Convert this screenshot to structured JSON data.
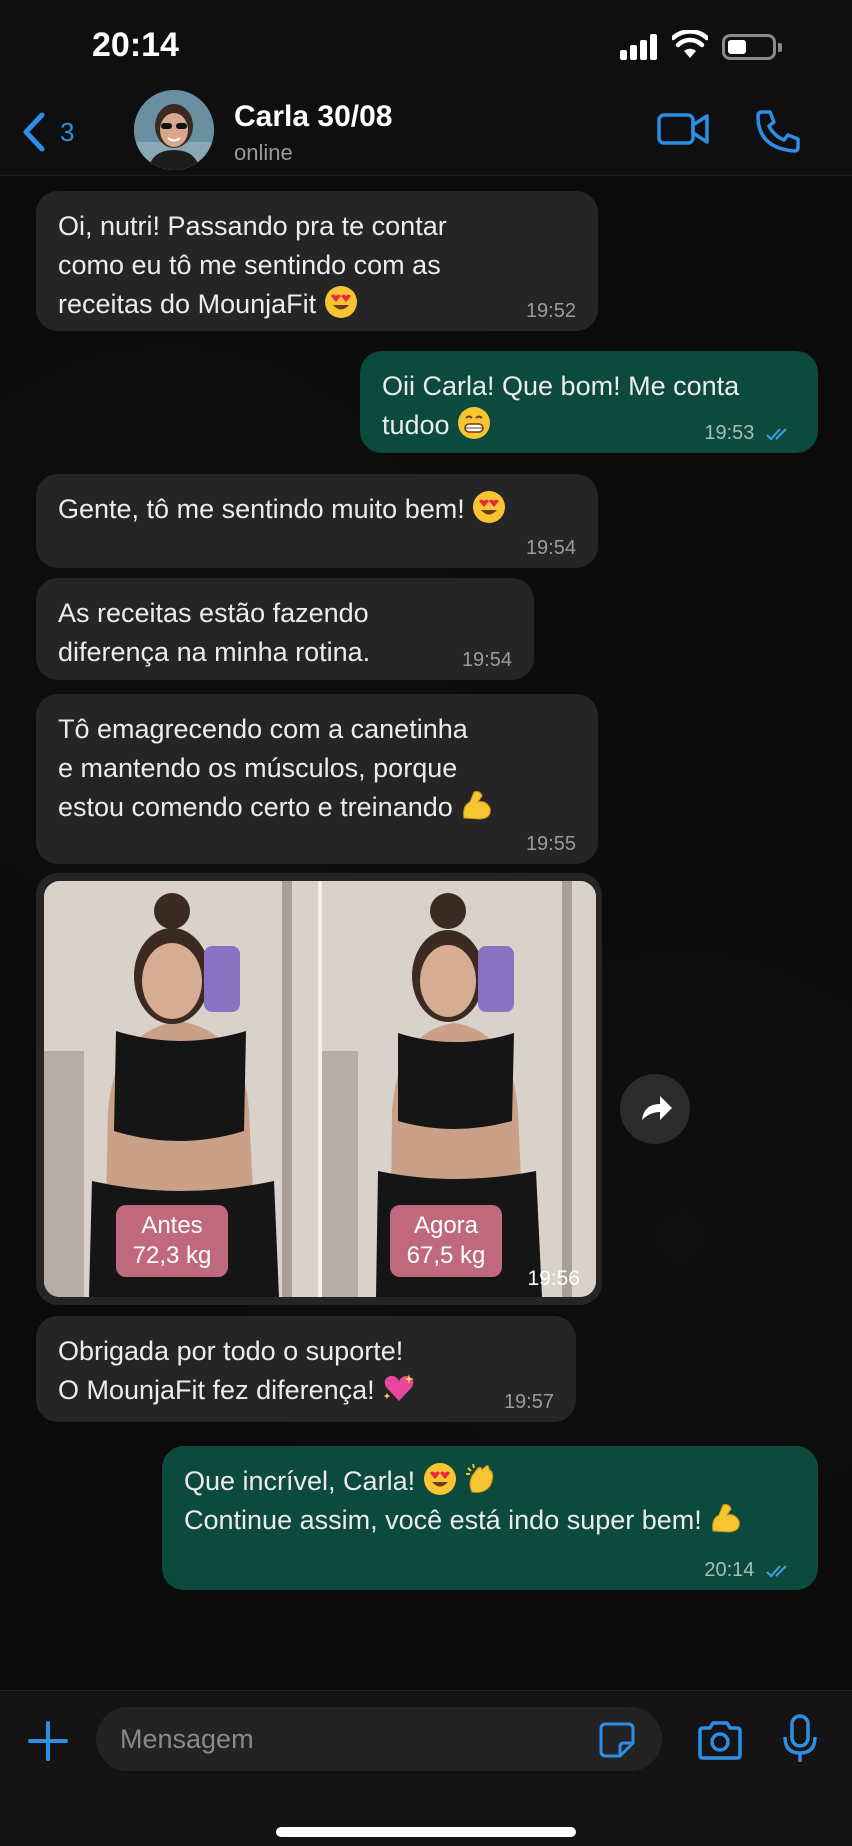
{
  "status_bar": {
    "time": "20:14"
  },
  "header": {
    "back_count": "3",
    "contact_name": "Carla 30/08",
    "contact_status": "online"
  },
  "messages": [
    {
      "direction": "in",
      "lines": [
        "Oi, nutri! Passando pra te contar",
        "como eu tô me sentindo com as",
        "receitas do MounjaFit"
      ],
      "emoji": "heart-eyes",
      "time": "19:52"
    },
    {
      "direction": "out",
      "lines": [
        "Oii Carla! Que bom! Me conta",
        "tudoo"
      ],
      "emoji": "grin",
      "time": "19:53"
    },
    {
      "direction": "in",
      "lines": [
        "Gente, tô me sentindo muito bem!"
      ],
      "emoji": "heart-eyes",
      "time": "19:54"
    },
    {
      "direction": "in",
      "lines": [
        "As receitas estão fazendo",
        "diferença na minha rotina."
      ],
      "time": "19:54"
    },
    {
      "direction": "in",
      "lines": [
        "Tô emagrecendo com a canetinha",
        "e mantendo os músculos, porque",
        "estou comendo certo e treinando"
      ],
      "emoji": "flexed-biceps",
      "time": "19:55"
    },
    {
      "direction": "in",
      "type": "photo",
      "time": "19:56",
      "photo_before": {
        "label": "Antes",
        "weight": "72,3 kg"
      },
      "photo_after": {
        "label": "Agora",
        "weight": "67,5 kg"
      }
    },
    {
      "direction": "in",
      "lines": [
        "Obrigada por todo o suporte!",
        "O MounjaFit fez diferença!"
      ],
      "emoji": "sparkling-heart",
      "time": "19:57"
    },
    {
      "direction": "out",
      "lines": [
        "Que incrível, Carla!",
        "Continue assim, você está indo super bem!"
      ],
      "emoji": "heart-eyes clapping flexed-biceps",
      "time": "20:14"
    }
  ],
  "input": {
    "placeholder": "Mensagem"
  },
  "colors": {
    "accent": "#2d8ee8",
    "bubble_in": "#252525",
    "bubble_out": "#0b4a3c",
    "tag": "#c0697c"
  }
}
